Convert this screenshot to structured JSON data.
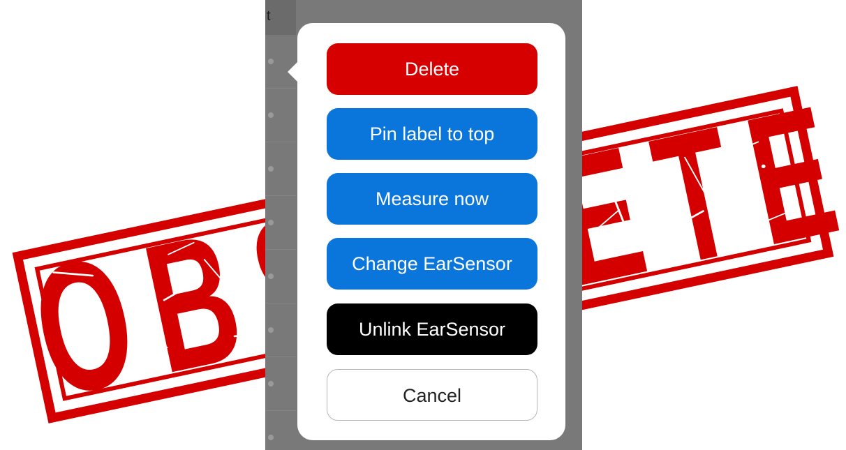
{
  "stamp": {
    "text": "OBSOLETE",
    "color": "#d40000"
  },
  "background_screen": {
    "header_text": "t",
    "row_count": 8
  },
  "action_sheet": {
    "buttons": [
      {
        "id": "delete",
        "label": "Delete",
        "style": "destructive",
        "color": "#d70000"
      },
      {
        "id": "pin-label",
        "label": "Pin label to top",
        "style": "primary",
        "color": "#0a76dc"
      },
      {
        "id": "measure-now",
        "label": "Measure now",
        "style": "primary",
        "color": "#0a76dc"
      },
      {
        "id": "change-earsensor",
        "label": "Change EarSensor",
        "style": "primary",
        "color": "#0a76dc"
      },
      {
        "id": "unlink-earsensor",
        "label": "Unlink EarSensor",
        "style": "dark",
        "color": "#000000"
      },
      {
        "id": "cancel",
        "label": "Cancel",
        "style": "secondary",
        "color": "#ffffff"
      }
    ]
  }
}
